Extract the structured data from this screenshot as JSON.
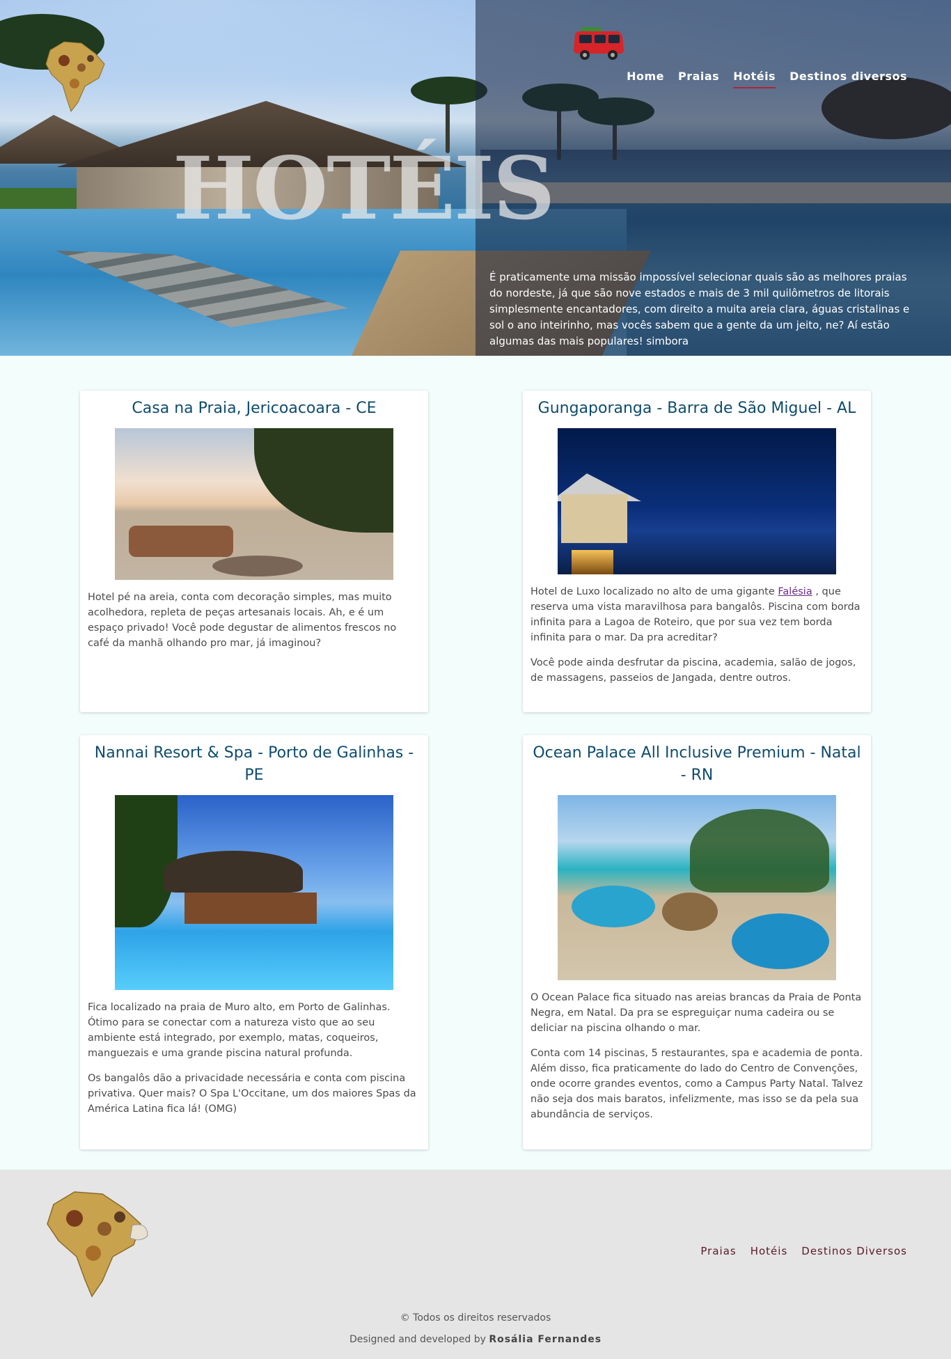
{
  "nav": {
    "items": [
      "Home",
      "Praias",
      "Hotéis",
      "Destinos diversos"
    ],
    "active": "Hotéis"
  },
  "hero": {
    "title": "HOTÉIS",
    "text": "É praticamente uma missão impossível selecionar quais são as melhores praias do nordeste, já que são nove estados e mais de 3 mil quilômetros de litorais simplesmente encantadores, com direito a muita areia clara, águas cristalinas e sol o ano inteirinho, mas vocês sabem que a gente da um jeito, ne? Aí estão algumas das mais populares! simbora"
  },
  "cards": [
    {
      "title": "Casa na Praia, Jericoacoara - CE",
      "paragraphs": [
        "Hotel pé na areia, conta com decoração simples, mas muito acolhedora, repleta de peças artesanais locais. Ah, e é um espaço privado! Você pode degustar de alimentos frescos no café da manhã olhando pro mar, já imaginou?"
      ]
    },
    {
      "title": "Gungaporanga - Barra de São Miguel - AL",
      "p1_before": "Hotel de Luxo localizado no alto de uma gigante ",
      "p1_link": "Falésia",
      "p1_after": " , que reserva uma vista maravilhosa para bangalôs. Piscina com borda infinita para a Lagoa de Roteiro, que por sua vez tem borda infinita para o mar. Da pra acreditar?",
      "p2": "Você pode ainda desfrutar da piscina, academia, salão de jogos, de massagens, passeios de Jangada, dentre outros."
    },
    {
      "title": "Nannai Resort & Spa - Porto de Galinhas - PE",
      "paragraphs": [
        "Fica localizado na praia de Muro alto, em Porto de Galinhas. Ótimo para se conectar com a natureza visto que ao seu ambiente está integrado, por exemplo, matas, coqueiros, manguezais e uma grande piscina natural profunda.",
        "Os bangalôs dão a privacidade necessária e conta com piscina privativa. Quer mais? O Spa L'Occitane, um dos maiores Spas da América Latina fica lá! (OMG)"
      ]
    },
    {
      "title": "Ocean Palace All Inclusive Premium - Natal - RN",
      "paragraphs": [
        "O Ocean Palace fica situado nas areias brancas da Praia de Ponta Negra, em Natal. Da pra se espreguiçar numa cadeira ou se deliciar na piscina olhando o mar.",
        "Conta com 14 piscinas, 5 restaurantes, spa e academia de ponta. Além disso, fica praticamente do lado do Centro de Convenções, onde ocorre grandes eventos, como a Campus Party Natal. Talvez não seja dos mais baratos, infelizmente, mas isso se da pela sua abundância de serviços."
      ]
    }
  ],
  "footer": {
    "nav": [
      "Praias",
      "Hotéis",
      "Destinos Diversos"
    ],
    "copyright": "© Todos os direitos reservados",
    "credit_prefix": "Designed and developed by ",
    "author": "Rosália Fernandes"
  },
  "colors": {
    "page_bg": "#f2fdfc",
    "card_title": "#0f4c6e",
    "nav_active_underline": "#b0223c",
    "footer_bg": "#e5e5e5",
    "footer_link": "#5a1a28"
  },
  "icons": [
    "northeast-map-logo",
    "red-van-icon"
  ]
}
